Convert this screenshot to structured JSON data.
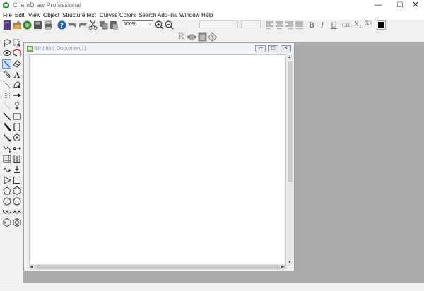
{
  "window": {
    "title": "ChemDraw Professional",
    "minimize": "—",
    "maximize": "☐",
    "close": "✕"
  },
  "menu": [
    "File",
    "Edit",
    "View",
    "Object",
    "Structure",
    "Text",
    "Curves",
    "Colors",
    "Search",
    "Add-ins",
    "Window",
    "Help"
  ],
  "toolbar": {
    "zoom_value": "100%",
    "format": {
      "bold": "B",
      "italic": "I",
      "underline": "U",
      "ch2": "CH₂",
      "subscript": "X₂",
      "superscript": "X²"
    },
    "chem_r": "R"
  },
  "document": {
    "title": "Untitled Document-1",
    "min": "▭",
    "max": "▢",
    "close": "✕"
  },
  "icons": {
    "toolbar": [
      "new-document-icon",
      "open-icon",
      "save-icon",
      "save-all-icon",
      "print-icon",
      "help-icon",
      "undo-icon",
      "redo-icon",
      "cut-icon",
      "copy-icon",
      "paste-icon",
      "zoom-in-icon",
      "zoom-out-icon"
    ],
    "palette": [
      "lasso-icon",
      "marquee-icon",
      "rotate-icon",
      "structure-perspective-icon",
      "bond-tool-icon",
      "eraser-icon",
      "multi-bond-icon",
      "text-tool-icon",
      "dashed-bond-icon",
      "pen-tool-icon",
      "hash-bond-icon",
      "arrow-tool-icon",
      "wedge-bond-icon",
      "orbital-icon",
      "single-bond-icon",
      "rectangle-icon",
      "bold-bond-icon",
      "bracket-icon",
      "wedge-hash-icon",
      "chain-icon",
      "chemical-symbol-icon",
      "atom-map-icon",
      "table-icon",
      "tlc-plate-icon",
      "query-tool-icon",
      "template-icon",
      "triangle-icon",
      "square-icon",
      "pentagon-icon",
      "hexagon-icon",
      "cyclopentane-icon",
      "cyclohexane-icon",
      "chair-1-icon",
      "chair-2-icon",
      "benzene-icon",
      "cycloheptane-icon"
    ]
  },
  "colors": {
    "accent": "#2a6cc4",
    "mdi_bg": "#ababab",
    "canvas": "#ffffff"
  }
}
